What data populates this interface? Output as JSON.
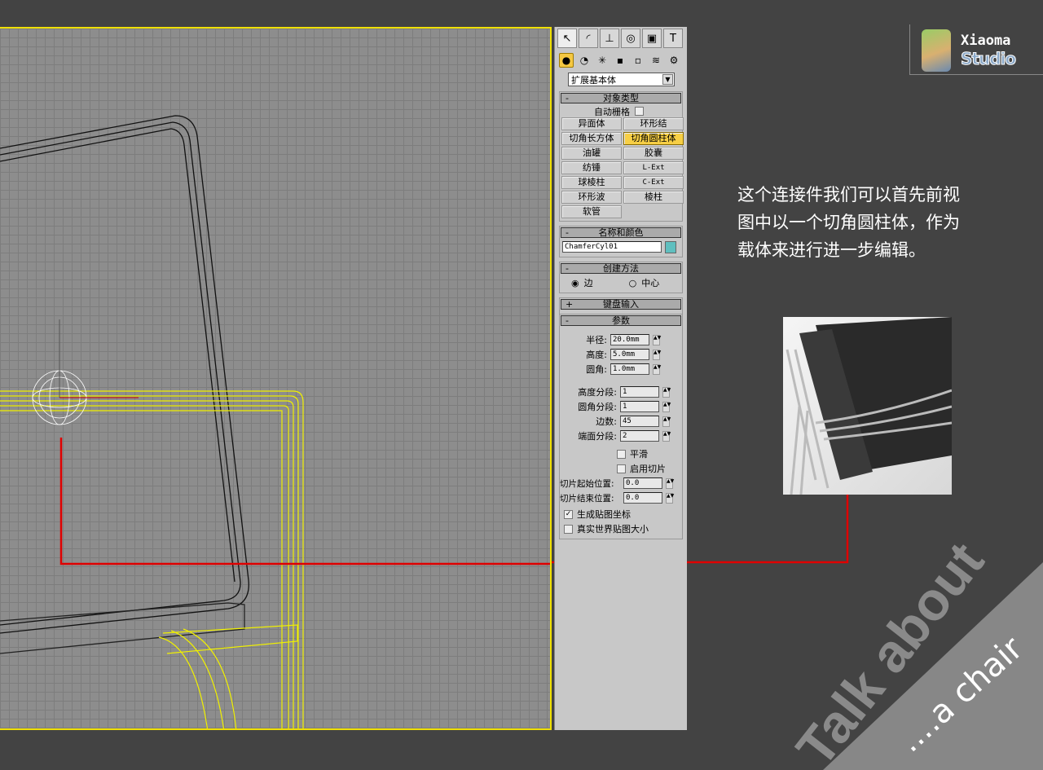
{
  "panel": {
    "tabs": [
      "create-icon",
      "modify-icon",
      "hierarchy-icon",
      "motion-icon",
      "display-icon",
      "utilities-icon"
    ],
    "subtabs": [
      "geometry-icon",
      "shapes-icon",
      "lights-icon",
      "cameras-icon",
      "helpers-icon",
      "spacewarps-icon",
      "systems-icon"
    ],
    "category": "扩展基本体",
    "object_type": {
      "title": "对象类型",
      "autogrid": "自动栅格",
      "buttons": [
        "异面体",
        "环形结",
        "切角长方体",
        "切角圆柱体",
        "油罐",
        "胶囊",
        "纺锤",
        "L-Ext",
        "球棱柱",
        "C-Ext",
        "环形波",
        "棱柱",
        "软管"
      ],
      "active": "切角圆柱体"
    },
    "name_color": {
      "title": "名称和颜色",
      "name": "ChamferCyl01",
      "color": "#5fbfbf"
    },
    "creation": {
      "title": "创建方法",
      "edge": "边",
      "center": "中心",
      "selected": "边"
    },
    "keyboard": {
      "title": "键盘输入"
    },
    "params": {
      "title": "参数",
      "radius_label": "半径:",
      "radius": "20.0mm",
      "height_label": "高度:",
      "height": "5.0mm",
      "fillet_label": "圆角:",
      "fillet": "1.0mm",
      "hseg_label": "高度分段:",
      "hseg": "1",
      "fseg_label": "圆角分段:",
      "fseg": "1",
      "sides_label": "边数:",
      "sides": "45",
      "cseg_label": "端面分段:",
      "cseg": "2",
      "smooth": "平滑",
      "slice_on": "启用切片",
      "slice_from_label": "切片起始位置:",
      "slice_from": "0.0",
      "slice_to_label": "切片结束位置:",
      "slice_to": "0.0",
      "gen_map": "生成贴图坐标",
      "real_world": "真实世界贴图大小"
    }
  },
  "description": "这个连接件我们可以首先前视图中以一个切角圆柱体，作为载体来进行进一步编辑。",
  "logo": {
    "line1": "Xiaoma",
    "line2": "Studio"
  },
  "tagline": {
    "main": "Talk about",
    "sub": "....a chair"
  },
  "colors": {
    "accent": "#f7cf45",
    "callout": "#e00000",
    "selection": "#f0f000"
  }
}
